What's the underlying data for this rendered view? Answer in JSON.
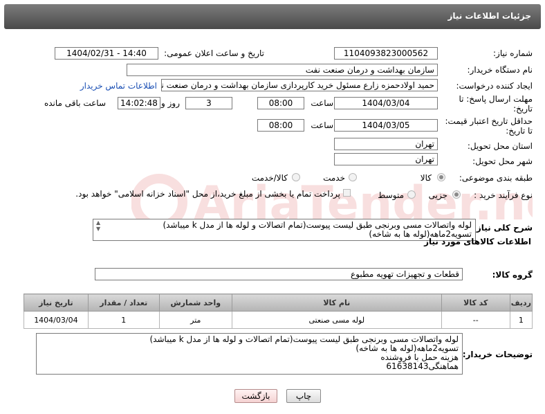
{
  "header": {
    "title": "جزئیات اطلاعات نیاز"
  },
  "form": {
    "need_number": {
      "label": "شماره نیاز:",
      "value": "1104093823000562"
    },
    "announce": {
      "label": "تاریخ و ساعت اعلان عمومی:",
      "value": "1404/02/31 - 14:40"
    },
    "buyer_org": {
      "label": "نام دستگاه خریدار:",
      "value": "سازمان بهداشت و درمان صنعت نفت"
    },
    "creator": {
      "label": "ایجاد کننده درخواست:",
      "value": "حمید اولادحمزه زارع مسئول خرید کارپردازی سازمان بهداشت و درمان صنعت نفت",
      "contact_link": "اطلاعات تماس خریدار"
    },
    "deadline": {
      "label_line1": "مهلت ارسال پاسخ: تا",
      "label_line2": "تاریخ:",
      "date": "1404/03/04",
      "time_label": "ساعت",
      "time": "08:00",
      "days": "3",
      "days_label": "روز و",
      "remaining": "14:02:48",
      "remaining_label": "ساعت باقی مانده"
    },
    "price_validity": {
      "label_line1": "حداقل تاریخ اعتبار قیمت:",
      "label_line2": "تا تاریخ:",
      "date": "1404/03/05",
      "time_label": "ساعت",
      "time": "08:00"
    },
    "province": {
      "label": "استان محل تحویل:",
      "value": "تهران"
    },
    "city": {
      "label": "شهر محل تحویل:",
      "value": "تهران"
    },
    "category": {
      "label": "طبقه بندی موضوعی:",
      "options": [
        "کالا",
        "خدمت",
        "کالا/خدمت"
      ],
      "selected": "کالا"
    },
    "process": {
      "label": "نوع فرآیند خرید :",
      "options": [
        "جزیی",
        "متوسط"
      ],
      "selected": "جزیی",
      "payment_note": "پرداخت تمام یا بخشی از مبلغ خرید،از محل \"اسناد خزانه اسلامی\" خواهد بود."
    }
  },
  "description": {
    "label": "شرح کلی نیاز:",
    "text": "لوله واتصالات مسی وبرنجی طبق لیست پیوست(تمام اتصالات و لوله ها از مدل k میباشد)\nتسویه2ماهه(لوله ها به شاخه)"
  },
  "goods": {
    "section_title": "اطلاعات کالاهای مورد نیاز",
    "group_label": "گروه کالا:",
    "group_value": "قطعات و تجهیزات تهویه مطبوع",
    "columns": [
      "ردیف",
      "کد کالا",
      "نام کالا",
      "واحد شمارش",
      "تعداد / مقدار",
      "تاریخ نیاز"
    ],
    "rows": [
      [
        "1",
        "--",
        "لوله مسی صنعتی",
        "متر",
        "1",
        "1404/03/04"
      ]
    ]
  },
  "buyer_notes": {
    "label": "توضیحات خریدار:",
    "text": "لوله واتصالات مسی وبرنجی طبق لیست پیوست(تمام اتصالات و لوله ها از مدل k میباشد)\nتسویه2ماهه(لوله ها به شاخه)\nهزینه حمل با فروشنده\nهماهنگی61638143"
  },
  "buttons": {
    "print": "چاپ",
    "back": "بازگشت"
  },
  "watermark": {
    "text": "AriaTender.net"
  }
}
